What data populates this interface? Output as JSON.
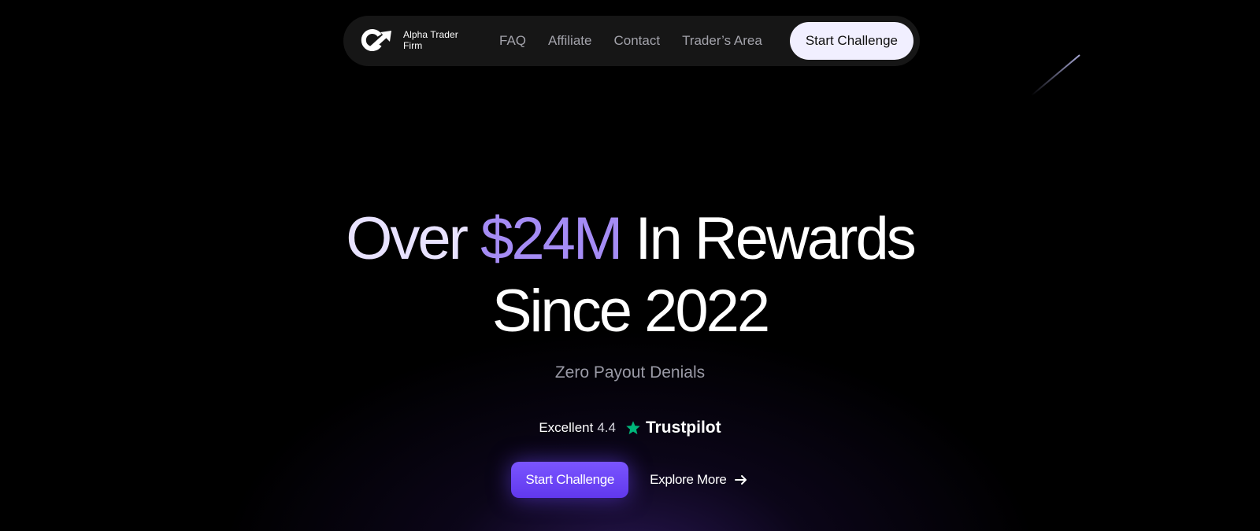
{
  "brand": {
    "name": "Alpha Trader Firm",
    "logo_icon": "alpha-trader-logo-icon"
  },
  "nav": {
    "links": [
      "FAQ",
      "Affiliate",
      "Contact",
      "Trader’s Area"
    ],
    "cta_label": "Start Challenge"
  },
  "hero": {
    "title_part1": "Over ",
    "title_highlight": "$24M",
    "title_part2": " In Rewards",
    "title_line2": "Since 2022",
    "subtitle": "Zero Payout Denials"
  },
  "rating": {
    "label": "Excellent",
    "score": "4.4",
    "star_icon": "star-icon",
    "source": "Trustpilot"
  },
  "actions": {
    "primary_label": "Start Challenge",
    "secondary_label": "Explore More",
    "secondary_icon": "arrow-right-icon"
  },
  "colors": {
    "accent": "#a58cf5",
    "primary_button": "#6d45f7",
    "trustpilot_star": "#00b67a",
    "background": "#000000"
  }
}
